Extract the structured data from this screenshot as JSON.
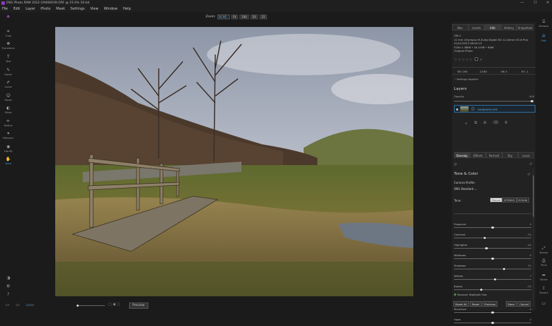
{
  "window": {
    "title": "ON1 Photo RAW 2022 OA060039.ORF @ 25.6% 16-bit",
    "minimize": "—",
    "maximize": "☐",
    "close": "✕"
  },
  "menu": [
    "File",
    "Edit",
    "Layer",
    "Photo",
    "Mask",
    "Settings",
    "View",
    "Window",
    "Help"
  ],
  "zoom": {
    "label": "Zoom:",
    "value": "34.98",
    "buttons": [
      "Fit",
      "100",
      "50",
      "25"
    ]
  },
  "left_tools": [
    {
      "name": "crop",
      "label": "Crop",
      "icon": "⌗"
    },
    {
      "name": "transform",
      "label": "Transform",
      "icon": "✥"
    },
    {
      "name": "text",
      "label": "Text",
      "icon": "T"
    },
    {
      "name": "super",
      "label": "Super",
      "icon": "✎"
    },
    {
      "name": "local",
      "label": "Local",
      "icon": "✐"
    },
    {
      "name": "faces",
      "label": "Faces",
      "icon": "☺"
    },
    {
      "name": "mask",
      "label": "Mask",
      "icon": "◐"
    },
    {
      "name": "refine",
      "label": "Refine",
      "icon": "✏"
    },
    {
      "name": "retouch",
      "label": "Retouch",
      "icon": "✦"
    },
    {
      "name": "liquify",
      "label": "Liquify",
      "icon": "◉"
    },
    {
      "name": "view",
      "label": "View",
      "icon": "✋"
    }
  ],
  "bottom": {
    "preview": "Preview"
  },
  "right_tabs": [
    "Nav",
    "Levels",
    "Info",
    "History",
    "Snapshots"
  ],
  "active_right_tab": "Info",
  "info_lines": [
    "OM-1",
    "12 mm (Olympus M.Zuiko Digital ED 12-40mm f/2.8 Pro)",
    "31/01/2023 08:55:13",
    "5184 x 3888 • 18.4 MB • RAW",
    "Original Photo"
  ],
  "exif": [
    "ISO 200",
    "1/160",
    "f/6.3",
    "EV -1"
  ],
  "settings_applied": "Settings Applied",
  "layers": {
    "title": "Layers",
    "opacity_label": "Opacity",
    "opacity_value": "100",
    "opacity": 1.0,
    "layer_name": "OA060039.ORF"
  },
  "module_tabs": [
    "Develop",
    "Effects",
    "Portrait",
    "Sky",
    "Local"
  ],
  "active_module_tab": "Develop",
  "tone_color": {
    "title": "Tone & Color",
    "camera_profile_label": "Camera Profile:",
    "camera_profile_value": "ON1 Standard",
    "tone_label": "Tone:",
    "tone_modes": [
      "Manual",
      "AI Match",
      "AI Auto"
    ],
    "active_tone_mode": "Manual"
  },
  "sliders": [
    {
      "label": "Exposure",
      "value": "0",
      "pos": 0.5
    },
    {
      "label": "Contrast",
      "value": "-20",
      "pos": 0.4
    },
    {
      "label": "Highlights",
      "value": "-40",
      "pos": 0.42
    },
    {
      "label": "Midtones",
      "value": "0",
      "pos": 0.5
    },
    {
      "label": "Shadows",
      "value": "31",
      "pos": 0.65
    },
    {
      "label": "Whites",
      "value": "7",
      "pos": 0.53
    },
    {
      "label": "Blacks",
      "value": "-20",
      "pos": 0.35
    },
    {
      "label": "Structure",
      "value": "0",
      "pos": 0.5
    },
    {
      "label": "Haze",
      "value": "0",
      "pos": 0.5
    }
  ],
  "recover": "Recover Highlight Hue",
  "right_buttons": [
    "Reset All",
    "Reset",
    "Previous",
    "Done",
    "Cancel"
  ],
  "far_right": [
    {
      "name": "browse",
      "label": "Browse",
      "icon": "⌸"
    },
    {
      "name": "edit",
      "label": "Edit",
      "icon": "✇"
    },
    {
      "name": "resize",
      "label": "Resize",
      "icon": "⤢"
    },
    {
      "name": "print",
      "label": "Print",
      "icon": "⎙"
    },
    {
      "name": "share",
      "label": "Share",
      "icon": "➦"
    },
    {
      "name": "export",
      "label": "Export",
      "icon": "⇪"
    }
  ]
}
